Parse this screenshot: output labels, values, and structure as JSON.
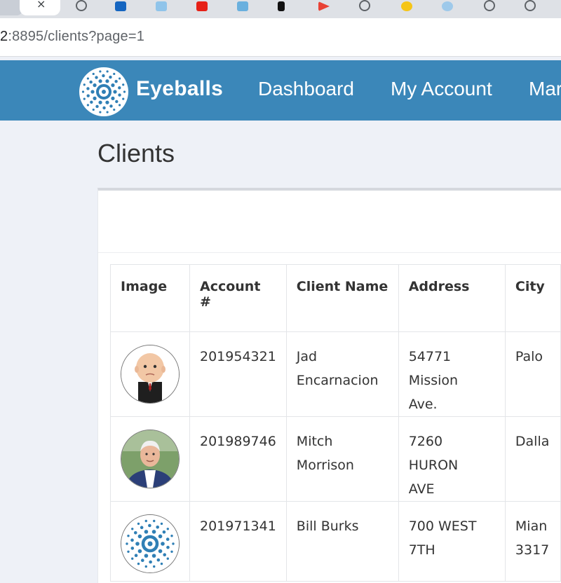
{
  "browser": {
    "url_host": "2",
    "url_path": ":8895/clients?page=1"
  },
  "navbar": {
    "brand": "Eyeballs",
    "links": [
      "Dashboard",
      "My Account",
      "Mar"
    ]
  },
  "page": {
    "title": "Clients"
  },
  "table": {
    "headers": [
      "Image",
      "Account #",
      "Client Name",
      "Address",
      "City"
    ],
    "rows": [
      {
        "account": "201954321",
        "name_line1": "Jad",
        "name_line2": "Encarnacion",
        "address_line1": "54771 Mission",
        "address_line2": "Ave.",
        "city_line1": "Palo",
        "city_line2": "",
        "avatar": "baby-avatar"
      },
      {
        "account": "201989746",
        "name_line1": "Mitch",
        "name_line2": "Morrison",
        "address_line1": "7260 HURON",
        "address_line2": "AVE",
        "city_line1": "Dalla",
        "city_line2": "",
        "avatar": "man-avatar"
      },
      {
        "account": "201971341",
        "name_line1": "Bill Burks",
        "name_line2": "",
        "address_line1": "700 WEST 7TH",
        "address_line2": "",
        "city_line1": "Mian",
        "city_line2": "3317",
        "avatar": "logo-avatar"
      }
    ]
  },
  "colors": {
    "navbar": "#3b87b9",
    "page_bg": "#eef1f7",
    "logo_blue": "#2f7fb5"
  }
}
